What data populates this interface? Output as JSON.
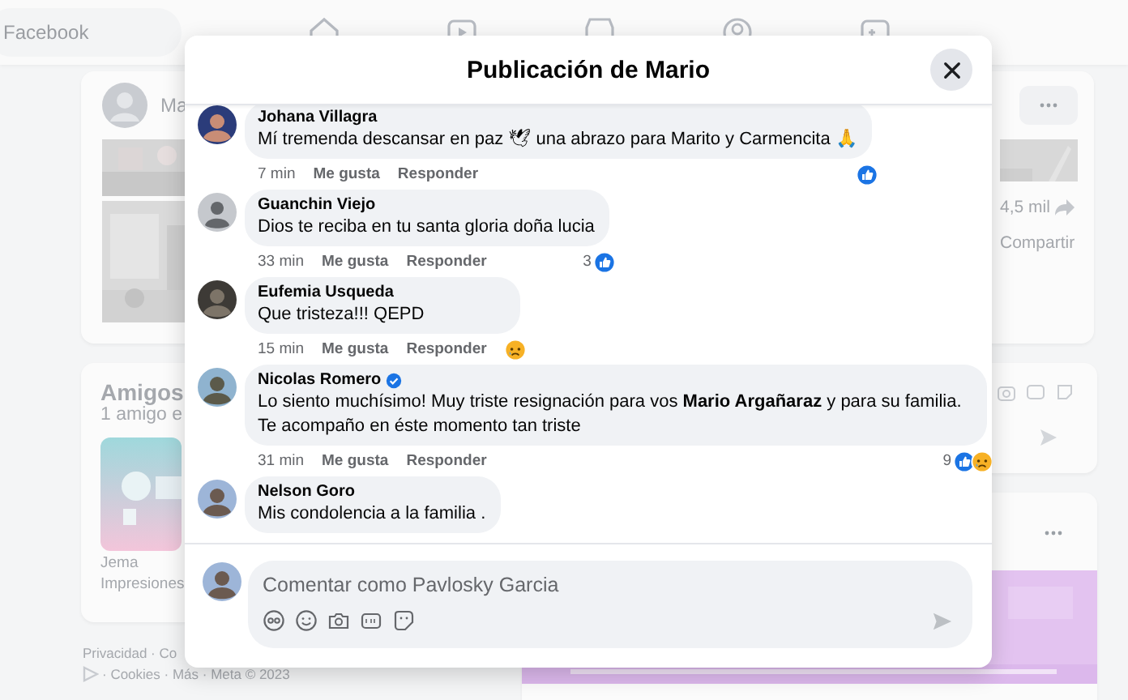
{
  "background": {
    "search_placeholder": "Facebook",
    "post_author": "Ma",
    "share_count": "4,5 mil",
    "share_label": "Compartir",
    "friends_title": "Amigos",
    "friends_subtitle": "1 amigo e",
    "friend_name": "Jema",
    "friend_detail": "Impresiones",
    "footer_lines": [
      "Privacidad · Co",
      "· Cookies · Más · Meta © 2023"
    ]
  },
  "dialog": {
    "title": "Publicación de Mario",
    "comments": [
      {
        "author": "Johana Villagra",
        "verified": false,
        "text": "Mí tremenda descansar en paz 🕊 una abrazo para Marito y Carmencita 🙏",
        "time": "7 min",
        "like_label": "Me gusta",
        "reply_label": "Responder",
        "reactions": {
          "icons": [
            {
              "kind": "like"
            }
          ]
        }
      },
      {
        "author": "Guanchin Viejo",
        "avatar": {
          "kind": "default"
        },
        "verified": false,
        "text": "Dios te reciba en tu santa gloria doña lucia",
        "time": "33 min",
        "like_label": "Me gusta",
        "reply_label": "Responder",
        "reactions": {
          "count": "3",
          "icons": [
            {
              "kind": "like"
            }
          ]
        }
      },
      {
        "author": "Eufemia Usqueda",
        "verified": false,
        "text": "Que tristeza!!! QEPD",
        "time": "15 min",
        "like_label": "Me gusta",
        "reply_label": "Responder",
        "reactions": {
          "icons": [
            {
              "kind": "sad"
            }
          ]
        }
      },
      {
        "author": "Nicolas Romero",
        "verified": true,
        "text": "Lo siento muchísimo! Muy triste resignación para vos **Mario Argañaraz** y para su familia. Te acompaño en éste momento tan triste",
        "time": "31 min",
        "like_label": "Me gusta",
        "reply_label": "Responder",
        "reactions": {
          "count": "9",
          "icons": [
            {
              "kind": "like"
            },
            {
              "kind": "sad"
            }
          ]
        }
      },
      {
        "author": "Nelson Goro",
        "verified": false,
        "text": "Mis condolencia a la familia ."
      }
    ],
    "composer": {
      "placeholder": "Comentar como Pavlosky Garcia"
    }
  }
}
